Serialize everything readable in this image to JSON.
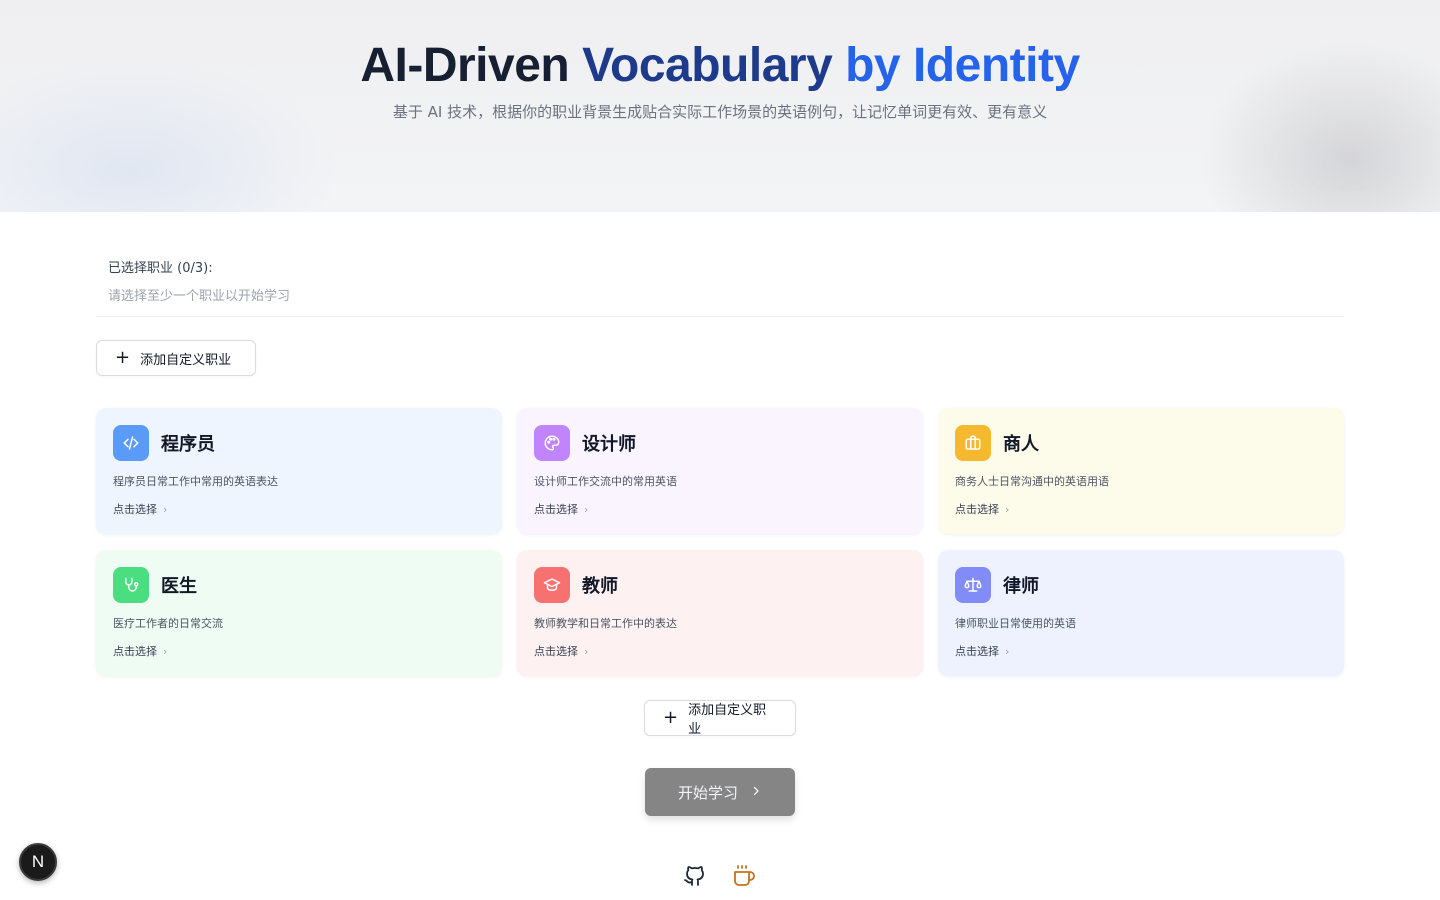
{
  "hero": {
    "title_part1": "AI-Driven ",
    "title_part2": "Vocabulary ",
    "title_part3": "by Identity",
    "subtitle": "基于 AI 技术，根据你的职业背景生成贴合实际工作场景的英语例句，让记忆单词更有效、更有意义"
  },
  "selection": {
    "label": "已选择职业 (0/3):",
    "hint": "请选择至少一个职业以开始学习"
  },
  "add_custom": {
    "icon": "plus-icon",
    "label": "添加自定义职业"
  },
  "professions": [
    {
      "name": "程序员",
      "desc": "程序员日常工作中常用的英语表达",
      "action": "点击选择",
      "icon": "code-icon",
      "color": "#5b9bf8"
    },
    {
      "name": "设计师",
      "desc": "设计师工作交流中的常用英语",
      "action": "点击选择",
      "icon": "palette-icon",
      "color": "#c084fc"
    },
    {
      "name": "商人",
      "desc": "商务人士日常沟通中的英语用语",
      "action": "点击选择",
      "icon": "briefcase-icon",
      "color": "#f5b82e"
    },
    {
      "name": "医生",
      "desc": "医疗工作者的日常交流",
      "action": "点击选择",
      "icon": "stethoscope-icon",
      "color": "#4ade80"
    },
    {
      "name": "教师",
      "desc": "教师教学和日常工作中的表达",
      "action": "点击选择",
      "icon": "graduation-cap-icon",
      "color": "#f87171"
    },
    {
      "name": "律师",
      "desc": "律师职业日常使用的英语",
      "action": "点击选择",
      "icon": "scale-icon",
      "color": "#818cf8"
    }
  ],
  "start_button": {
    "label": "开始学习",
    "icon": "chevron-right-icon",
    "color": "#858585"
  },
  "footer": {
    "icons": [
      "github-icon",
      "coffee-icon"
    ],
    "coffee_color": "#c2741a"
  },
  "dev_badge": {
    "letter": "N"
  }
}
